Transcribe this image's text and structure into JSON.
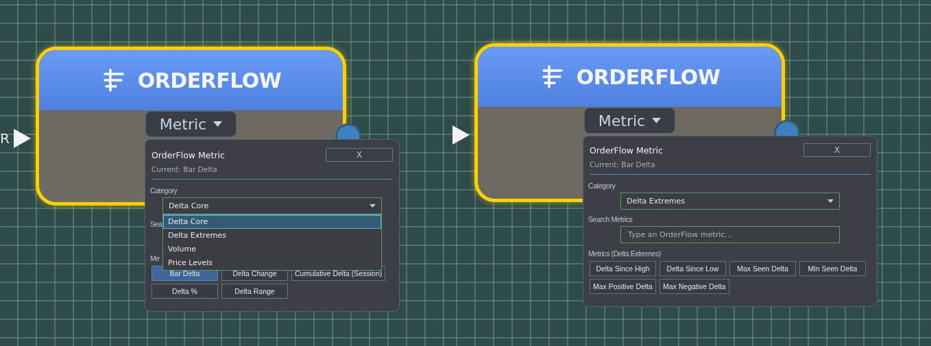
{
  "views": [
    {
      "node": {
        "title": "ORDERFLOW",
        "input_label": "R",
        "selector": "Metric"
      },
      "popup": {
        "title": "OrderFlow Metric",
        "close": "X",
        "current": "Current: Bar Delta",
        "category_label": "Category",
        "category": {
          "value": "Delta Core",
          "expanded": true,
          "options": [
            {
              "label": "Delta Core",
              "selected": true
            },
            {
              "label": "Delta Extremes",
              "selected": false
            },
            {
              "label": "Volume",
              "selected": false
            },
            {
              "label": "Price Levels",
              "selected": false
            }
          ]
        },
        "search_label": "Sea",
        "metrics_label": "Me",
        "metrics": [
          {
            "label": "Bar Delta",
            "selected": true
          },
          {
            "label": "Delta Change",
            "selected": false
          },
          {
            "label": "Cumulative Delta (Session)",
            "selected": false
          },
          {
            "label": "Delta %",
            "selected": false
          },
          {
            "label": "Delta Range",
            "selected": false
          }
        ]
      }
    },
    {
      "node": {
        "title": "ORDERFLOW",
        "selector": "Metric"
      },
      "popup": {
        "title": "OrderFlow Metric",
        "close": "X",
        "current": "Current: Bar Delta",
        "category_label": "Category",
        "category": {
          "value": "Delta Extremes",
          "expanded": false
        },
        "search_label": "Search Metrics",
        "search_field": {
          "placeholder": "Type an OrderFlow metric..."
        },
        "metrics_label": "Metrics (Delta Extremes)",
        "metrics": [
          {
            "label": "Delta Since High",
            "selected": false
          },
          {
            "label": "Delta Since Low",
            "selected": false
          },
          {
            "label": "Max Seen Delta",
            "selected": false
          },
          {
            "label": "Min Seen Delta",
            "selected": false
          },
          {
            "label": "Max Positive Delta",
            "selected": false
          },
          {
            "label": "Max Negative Delta",
            "selected": false
          }
        ]
      }
    }
  ]
}
